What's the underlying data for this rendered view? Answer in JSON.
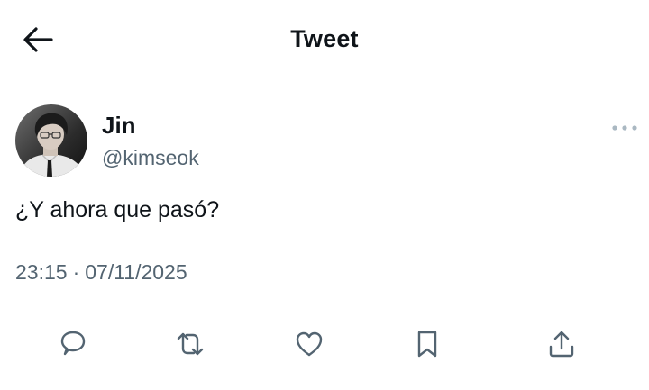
{
  "header": {
    "title": "Tweet",
    "back_icon": "arrow-left-icon"
  },
  "tweet": {
    "author": {
      "display_name": "Jin",
      "handle": "@kimseok",
      "avatar": "profile-photo"
    },
    "text": "¿Y ahora que pasó?",
    "time": "23:15",
    "separator": "·",
    "date": "07/11/2025",
    "more_icon": "more-horizontal-icon"
  },
  "actions": [
    {
      "icon": "reply-icon"
    },
    {
      "icon": "retweet-icon"
    },
    {
      "icon": "like-icon"
    },
    {
      "icon": "bookmark-icon"
    },
    {
      "icon": "share-icon"
    }
  ],
  "colors": {
    "text_primary": "#0f1419",
    "text_secondary": "#536471",
    "icon": "#536471",
    "background": "#ffffff"
  }
}
